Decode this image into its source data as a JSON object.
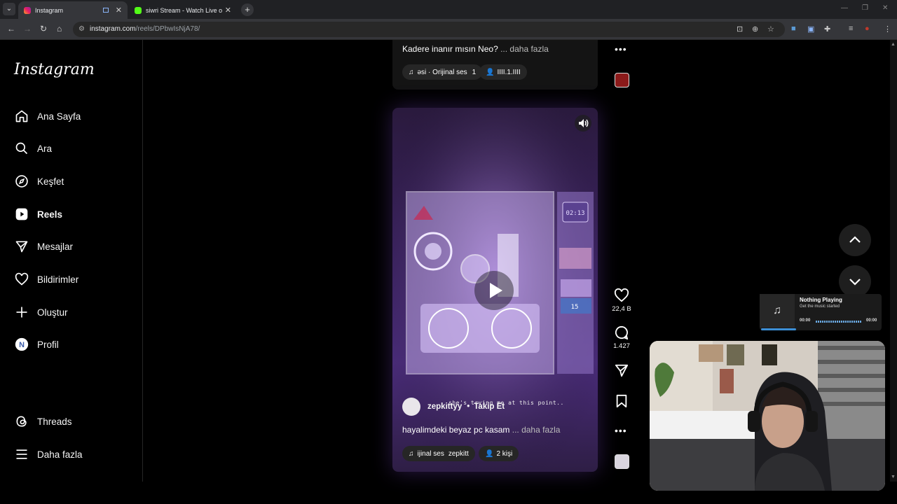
{
  "browser": {
    "tabs": [
      {
        "title": "Instagram",
        "active": true
      },
      {
        "title": "siwri Stream - Watch Live on Ki",
        "active": false
      }
    ],
    "url_host": "instagram.com",
    "url_path": "/reels/DPbwIsNjA78/"
  },
  "sidebar": {
    "logo": "Instagram",
    "items": [
      {
        "label": "Ana Sayfa",
        "icon": "home-icon"
      },
      {
        "label": "Ara",
        "icon": "search-icon"
      },
      {
        "label": "Keşfet",
        "icon": "compass-icon"
      },
      {
        "label": "Reels",
        "icon": "reels-icon"
      },
      {
        "label": "Mesajlar",
        "icon": "send-icon"
      },
      {
        "label": "Bildirimler",
        "icon": "heart-icon"
      },
      {
        "label": "Oluştur",
        "icon": "plus-icon"
      },
      {
        "label": "Profil",
        "icon": "profile-avatar"
      }
    ],
    "bottom": [
      {
        "label": "Threads",
        "icon": "threads-icon"
      },
      {
        "label": "Daha fazla",
        "icon": "menu-icon"
      }
    ]
  },
  "prev_reel": {
    "caption": "Kadere inanır mısın Neo?",
    "more": "... daha fazla",
    "audio": "əsi · Orijinal ses",
    "audio_count": "1",
    "tagged": "IIII.1.IIII"
  },
  "reel": {
    "username": "zepkittyy",
    "separator": "•",
    "follow": "Takip Et",
    "overlay": "she's trying me at this point..",
    "caption": "hayalimdeki beyaz pc kasam",
    "more": "... daha fazla",
    "audio": "ijinal ses",
    "audio_user": "zepkitt",
    "people": "2 kişi",
    "likes": "22,4 B",
    "comments": "1.427"
  },
  "music_widget": {
    "title": "Nothing Playing",
    "subtitle": "Get the music started",
    "time_start": "00:00",
    "time_end": "00:00"
  },
  "colors": {
    "accent_purple": "#6b3fa0",
    "music_progress": "#3d8fd6"
  }
}
